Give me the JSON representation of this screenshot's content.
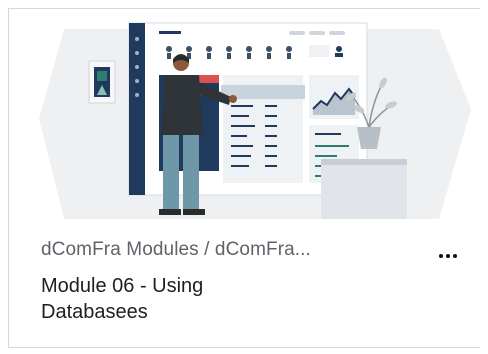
{
  "card": {
    "breadcrumb": "dComFra Modules / dComFra...",
    "title": "Module 06 - Using Databasees",
    "more_icon": "more-horizontal-icon",
    "thumbnail_icon": "dashboard-illustration"
  },
  "colors": {
    "navy": "#1f3a5c",
    "accent_teal": "#2e7d73",
    "panel_bg": "#eef2f5",
    "backdrop": "#eef0f2"
  }
}
